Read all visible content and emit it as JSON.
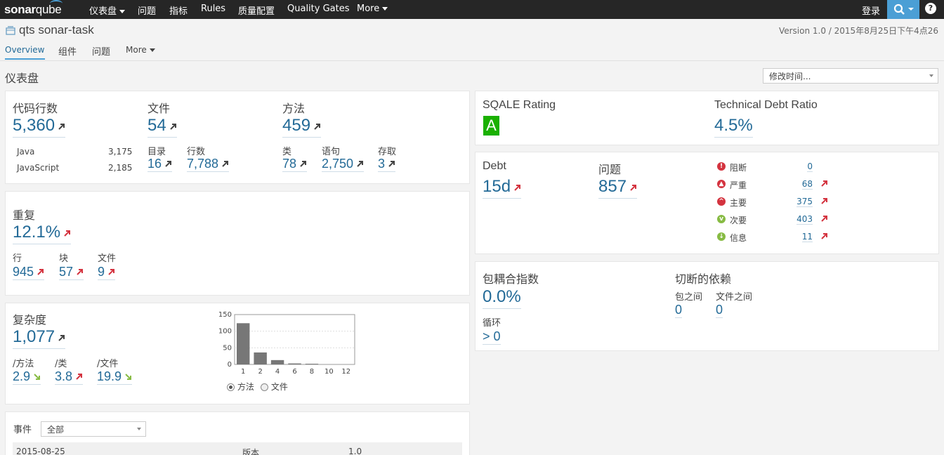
{
  "nav": {
    "logo_sonar": "sonar",
    "logo_qube": "qube",
    "items": [
      "仪表盘",
      "问题",
      "指标",
      "Rules",
      "质量配置",
      "Quality Gates",
      "More"
    ],
    "login": "登录"
  },
  "project": {
    "title": "qts sonar-task",
    "version": "Version 1.0 / 2015年8月25日下午4点26",
    "tabs": [
      "Overview",
      "组件",
      "问题",
      "More"
    ]
  },
  "page": {
    "title": "仪表盘",
    "period_select": "修改时间..."
  },
  "size": {
    "loc_label": "代码行数",
    "loc_value": "5,360",
    "languages": [
      {
        "name": "Java",
        "value": "3,175"
      },
      {
        "name": "JavaScript",
        "value": "2,185"
      }
    ],
    "files_label": "文件",
    "files_value": "54",
    "dirs_label": "目录",
    "dirs_value": "16",
    "lines_label": "行数",
    "lines_value": "7,788",
    "methods_label": "方法",
    "methods_value": "459",
    "classes_label": "类",
    "classes_value": "78",
    "statements_label": "语句",
    "statements_value": "2,750",
    "accessors_label": "存取",
    "accessors_value": "3"
  },
  "duplication": {
    "label": "重复",
    "value": "12.1%",
    "lines_label": "行",
    "lines_value": "945",
    "blocks_label": "块",
    "blocks_value": "57",
    "files_label": "文件",
    "files_value": "9"
  },
  "complexity": {
    "label": "复杂度",
    "value": "1,077",
    "per_method_label": "/方法",
    "per_method_value": "2.9",
    "per_class_label": "/类",
    "per_class_value": "3.8",
    "per_file_label": "/文件",
    "per_file_value": "19.9",
    "radio_method": "方法",
    "radio_file": "文件"
  },
  "chart_data": {
    "type": "bar",
    "categories": [
      "1",
      "2",
      "4",
      "6",
      "8",
      "10",
      "12"
    ],
    "values": [
      124,
      36,
      13,
      3,
      2,
      0,
      0
    ],
    "ylim": [
      0,
      150
    ],
    "yticks": [
      "0",
      "50",
      "100",
      "150"
    ],
    "bar_color": "#777777",
    "grid": true
  },
  "events": {
    "label": "事件",
    "filter": "全部",
    "rows": [
      {
        "date": "2015-08-25",
        "type": "版本",
        "name": "1.0"
      }
    ]
  },
  "sqale": {
    "rating_label": "SQALE Rating",
    "rating_value": "A",
    "rating_color": "#1ab000",
    "ratio_label": "Technical Debt Ratio",
    "ratio_value": "4.5%"
  },
  "debt": {
    "debt_label": "Debt",
    "debt_value": "15d",
    "issues_label": "问题",
    "issues_value": "857",
    "severities": [
      {
        "name": "阻断",
        "count": "0",
        "icon": "blocker-icon",
        "color": "#d4333f",
        "trend": false
      },
      {
        "name": "严重",
        "count": "68",
        "icon": "critical-icon",
        "color": "#d4333f",
        "trend": true
      },
      {
        "name": "主要",
        "count": "375",
        "icon": "major-icon",
        "color": "#d4333f",
        "trend": true
      },
      {
        "name": "次要",
        "count": "403",
        "icon": "minor-icon",
        "color": "#87bb43",
        "trend": true
      },
      {
        "name": "信息",
        "count": "11",
        "icon": "info-icon",
        "color": "#87bb43",
        "trend": true
      }
    ]
  },
  "package": {
    "tangle_label": "包耦合指数",
    "tangle_value": "0.0%",
    "cycles_label": "循环",
    "cycles_value": "> 0",
    "deps_label": "切断的依赖",
    "between_packages_label": "包之间",
    "between_packages_value": "0",
    "between_files_label": "文件之间",
    "between_files_value": "0"
  },
  "colors": {
    "link": "#236a97",
    "up_bad": "#d4333f",
    "down_good": "#87bb43",
    "neutral_arrow": "#444444",
    "nav_bg": "#262626",
    "accent": "#4b9fd5"
  }
}
